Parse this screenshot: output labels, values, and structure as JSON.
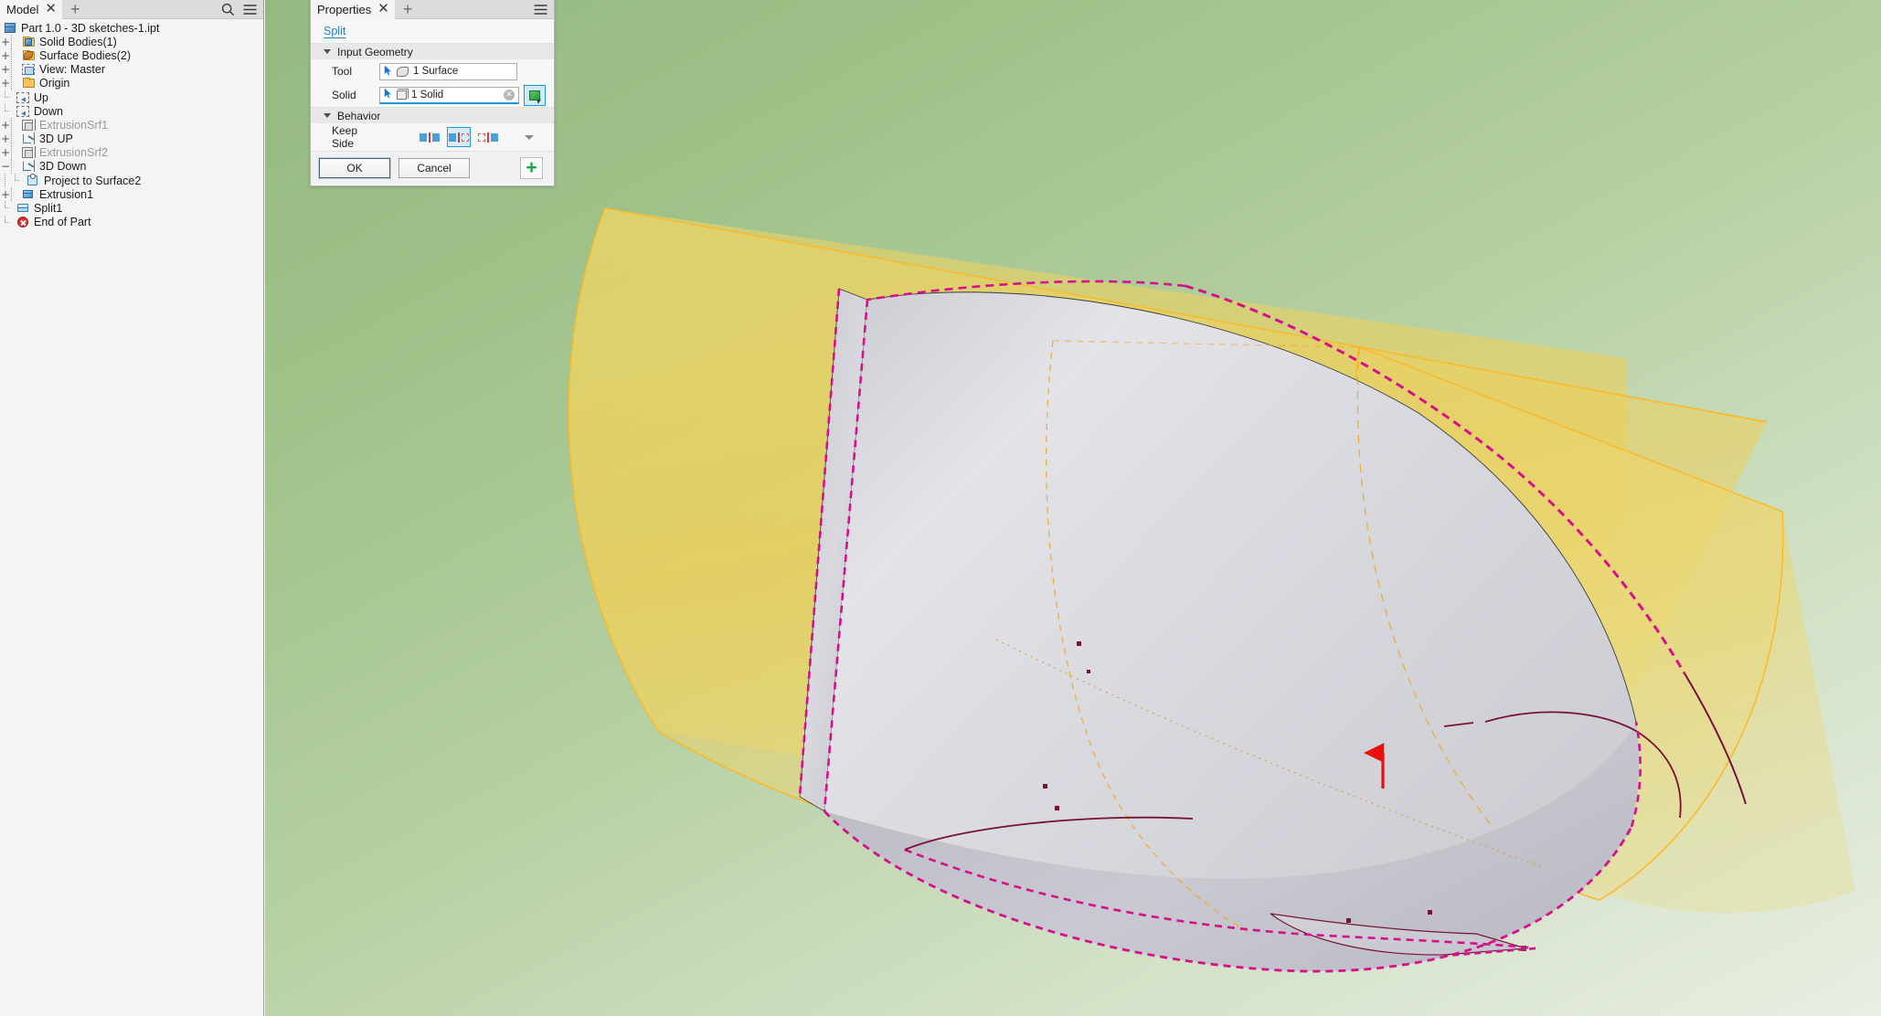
{
  "browser": {
    "tab": {
      "label": "Model",
      "close_icon": "close-icon",
      "add_icon": "plus-icon"
    },
    "toolbar": {
      "search_icon": "search-icon",
      "menu_icon": "hamburger-menu-icon"
    },
    "tree": [
      {
        "label": "Part 1.0 - 3D sketches-1.ipt",
        "icon": "part-icon",
        "indent": 0,
        "expander": "",
        "dim": false
      },
      {
        "label": "Solid Bodies(1)",
        "icon": "solid-bodies-folder-icon",
        "indent": 1,
        "expander": "+",
        "dim": false
      },
      {
        "label": "Surface Bodies(2)",
        "icon": "surface-bodies-folder-icon",
        "indent": 1,
        "expander": "+",
        "dim": false
      },
      {
        "label": "View: Master",
        "icon": "view-master-icon",
        "indent": 1,
        "expander": "+",
        "dim": false
      },
      {
        "label": "Origin",
        "icon": "origin-folder-icon",
        "indent": 1,
        "expander": "+",
        "dim": false
      },
      {
        "label": "Up",
        "icon": "sketch-icon",
        "indent": 1,
        "expander": "",
        "dim": false
      },
      {
        "label": "Down",
        "icon": "sketch-icon",
        "indent": 1,
        "expander": "",
        "dim": false
      },
      {
        "label": "ExtrusionSrf1",
        "icon": "extrusion-surface-icon",
        "indent": 1,
        "expander": "+",
        "dim": true
      },
      {
        "label": "3D UP",
        "icon": "3d-sketch-icon",
        "indent": 1,
        "expander": "+",
        "dim": false
      },
      {
        "label": "ExtrusionSrf2",
        "icon": "extrusion-surface-icon",
        "indent": 1,
        "expander": "+",
        "dim": true
      },
      {
        "label": "3D Down",
        "icon": "3d-sketch-icon",
        "indent": 1,
        "expander": "−",
        "dim": false
      },
      {
        "label": "Project to Surface2",
        "icon": "project-to-surface-icon",
        "indent": 2,
        "expander": "",
        "dim": false
      },
      {
        "label": "Extrusion1",
        "icon": "extrusion-icon",
        "indent": 1,
        "expander": "+",
        "dim": false
      },
      {
        "label": "Split1",
        "icon": "split-icon",
        "indent": 1,
        "expander": "",
        "dim": false
      },
      {
        "label": "End of Part",
        "icon": "end-of-part-icon",
        "indent": 1,
        "expander": "",
        "dim": false
      }
    ]
  },
  "properties": {
    "tab": {
      "label": "Properties",
      "close_icon": "close-icon",
      "add_icon": "plus-icon"
    },
    "menu_icon": "hamburger-menu-icon",
    "command_link": "Split",
    "sections": [
      {
        "title": "Input Geometry",
        "collapse_icon": "caret-down-icon"
      },
      {
        "title": "Behavior",
        "collapse_icon": "caret-down-icon"
      }
    ],
    "input_geometry": {
      "tool": {
        "label": "Tool",
        "value": "1 Surface",
        "cursor_icon": "select-arrow-icon",
        "type_icon": "surface-glyph-icon"
      },
      "solid": {
        "label": "Solid",
        "value": "1 Solid",
        "cursor_icon": "select-arrow-icon",
        "type_icon": "solid-glyph-icon",
        "clear_icon": "clear-selection-icon",
        "pick_icon": "select-solid-icon",
        "active": true
      }
    },
    "behavior": {
      "keep_side": {
        "label": "Keep Side",
        "options": [
          "keep-both",
          "keep-left",
          "keep-right"
        ],
        "selected_index": 1,
        "more_icon": "caret-down-icon"
      }
    },
    "buttons": {
      "ok": "OK",
      "cancel": "Cancel",
      "add_icon": "plus-icon"
    }
  },
  "viewport": {
    "background_top": "#94b981",
    "background_bottom": "#e8eee3",
    "surface_color": "#f0b90f",
    "solid_color": "#d5d5dc",
    "highlight_color": "#d70f8c",
    "edge_color": "#7a1038",
    "direction_arrow_color": "#e81010"
  }
}
